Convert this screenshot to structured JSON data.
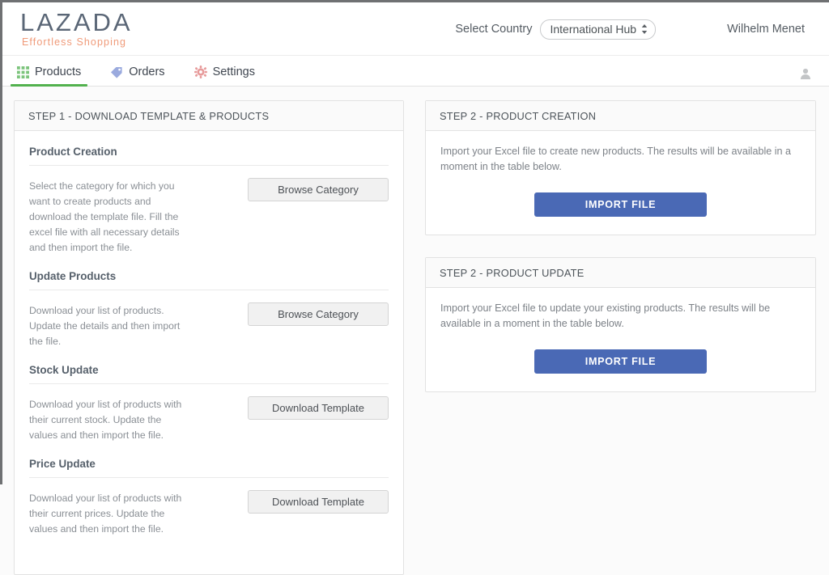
{
  "brand": {
    "logo_word": "LAZADA",
    "logo_tagline": "Effortless Shopping"
  },
  "header": {
    "select_country_label": "Select Country",
    "country_value": "International Hub",
    "country_options": [
      "International Hub"
    ],
    "user_name": "Wilhelm Menet",
    "updown_icon": "updown-chevron-icon"
  },
  "nav": {
    "items": [
      {
        "label": "Products",
        "icon": "grid-icon",
        "active": true
      },
      {
        "label": "Orders",
        "icon": "tag-icon",
        "active": false
      },
      {
        "label": "Settings",
        "icon": "gear-icon",
        "active": false
      }
    ],
    "avatar_icon": "user-icon"
  },
  "step1": {
    "title": "STEP 1 - DOWNLOAD TEMPLATE & PRODUCTS",
    "sections": [
      {
        "title": "Product Creation",
        "description": "Select the category for which you want to create products and download the template file. Fill the excel file with all necessary details and then import the file.",
        "button": "Browse Category"
      },
      {
        "title": "Update Products",
        "description": "Download your list of products. Update the details and then import the file.",
        "button": "Browse Category"
      },
      {
        "title": "Stock Update",
        "description": "Download your list of products with their current stock. Update the values and then import the file.",
        "button": "Download Template"
      },
      {
        "title": "Price Update",
        "description": "Download your list of products with their current prices. Update the values and then import the file.",
        "button": "Download Template"
      }
    ]
  },
  "step2_creation": {
    "title": "STEP 2 - PRODUCT CREATION",
    "description": "Import your Excel file to create new products. The results will be available in a moment in the table below.",
    "button": "IMPORT FILE"
  },
  "step2_update": {
    "title": "STEP 2 - PRODUCT UPDATE",
    "description": "Import your Excel file to update your existing products. The results will be available in a moment in the table below.",
    "button": "IMPORT FILE"
  },
  "colors": {
    "accent_green": "#52b14e",
    "primary_blue": "#4a69b5",
    "logo_gray": "#5a6676",
    "logo_orange": "#f09b7a",
    "tag_icon": "#9aaade",
    "gear_icon": "#e8a0a0"
  }
}
